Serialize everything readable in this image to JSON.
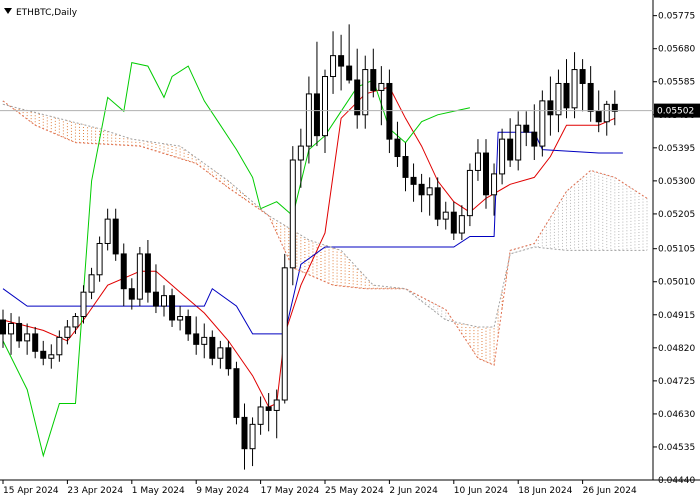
{
  "window": {
    "title": "ETHBTC,Daily",
    "arrow_icon": "triangle-down-icon"
  },
  "chart_data": {
    "type": "candlestick",
    "symbol": "ETHBTC",
    "timeframe": "Daily",
    "indicator": "Ichimoku Kinko Hyo",
    "ylim": [
      0.0444,
      0.0582
    ],
    "current_price": "0.05502",
    "y_ticks": [
      "0.05775",
      "0.05680",
      "0.05585",
      "0.05490",
      "0.05395",
      "0.05300",
      "0.05205",
      "0.05105",
      "0.05010",
      "0.04915",
      "0.04820",
      "0.04725",
      "0.04630",
      "0.04535",
      "0.04440"
    ],
    "x_labels": [
      {
        "label": "15 Apr 2024",
        "index": 0
      },
      {
        "label": "23 Apr 2024",
        "index": 8
      },
      {
        "label": "1 May 2024",
        "index": 16
      },
      {
        "label": "9 May 2024",
        "index": 24
      },
      {
        "label": "17 May 2024",
        "index": 32
      },
      {
        "label": "25 May 2024",
        "index": 40
      },
      {
        "label": "2 Jun 2024",
        "index": 48
      },
      {
        "label": "10 Jun 2024",
        "index": 56
      },
      {
        "label": "18 Jun 2024",
        "index": 64
      },
      {
        "label": "26 Jun 2024",
        "index": 72
      }
    ],
    "candles": [
      [
        0.049,
        0.0493,
        0.0482,
        0.0486
      ],
      [
        0.0486,
        0.0492,
        0.048,
        0.0489
      ],
      [
        0.0489,
        0.0491,
        0.0482,
        0.0484
      ],
      [
        0.0484,
        0.0489,
        0.048,
        0.0486
      ],
      [
        0.0486,
        0.0488,
        0.0479,
        0.0481
      ],
      [
        0.0481,
        0.0484,
        0.0477,
        0.0479
      ],
      [
        0.0479,
        0.0483,
        0.0476,
        0.048
      ],
      [
        0.048,
        0.0487,
        0.0478,
        0.0485
      ],
      [
        0.0485,
        0.049,
        0.0483,
        0.0488
      ],
      [
        0.0488,
        0.0492,
        0.0486,
        0.0491
      ],
      [
        0.0491,
        0.05,
        0.0489,
        0.0498
      ],
      [
        0.0498,
        0.0505,
        0.0496,
        0.0503
      ],
      [
        0.0503,
        0.0514,
        0.0501,
        0.0512
      ],
      [
        0.0512,
        0.0522,
        0.051,
        0.0519
      ],
      [
        0.0519,
        0.0522,
        0.0507,
        0.0509
      ],
      [
        0.0509,
        0.0512,
        0.0494,
        0.0499
      ],
      [
        0.0499,
        0.0502,
        0.0493,
        0.0496
      ],
      [
        0.0496,
        0.0511,
        0.0494,
        0.0509
      ],
      [
        0.0509,
        0.0513,
        0.0495,
        0.0498
      ],
      [
        0.0498,
        0.0506,
        0.0492,
        0.0494
      ],
      [
        0.0494,
        0.05,
        0.0491,
        0.0497
      ],
      [
        0.0497,
        0.0499,
        0.0488,
        0.049
      ],
      [
        0.049,
        0.0494,
        0.0487,
        0.0491
      ],
      [
        0.0491,
        0.0493,
        0.0484,
        0.0486
      ],
      [
        0.0486,
        0.0491,
        0.048,
        0.0483
      ],
      [
        0.0483,
        0.0489,
        0.0479,
        0.0485
      ],
      [
        0.0485,
        0.0487,
        0.0477,
        0.0479
      ],
      [
        0.0479,
        0.0484,
        0.0476,
        0.0482
      ],
      [
        0.0482,
        0.0484,
        0.0474,
        0.0476
      ],
      [
        0.0476,
        0.0478,
        0.046,
        0.0462
      ],
      [
        0.0462,
        0.0466,
        0.0447,
        0.0453
      ],
      [
        0.0453,
        0.0462,
        0.0448,
        0.046
      ],
      [
        0.046,
        0.0468,
        0.0457,
        0.0465
      ],
      [
        0.0465,
        0.0469,
        0.0458,
        0.0464
      ],
      [
        0.0464,
        0.047,
        0.0456,
        0.0467
      ],
      [
        0.0467,
        0.0509,
        0.0466,
        0.0505
      ],
      [
        0.0505,
        0.054,
        0.05,
        0.0536
      ],
      [
        0.0536,
        0.0545,
        0.0528,
        0.054
      ],
      [
        0.054,
        0.056,
        0.0535,
        0.0555
      ],
      [
        0.0555,
        0.057,
        0.054,
        0.0543
      ],
      [
        0.0543,
        0.0562,
        0.0538,
        0.056
      ],
      [
        0.056,
        0.0573,
        0.0555,
        0.0566
      ],
      [
        0.0566,
        0.0572,
        0.0556,
        0.0563
      ],
      [
        0.0563,
        0.0575,
        0.0558,
        0.0559
      ],
      [
        0.0559,
        0.0568,
        0.0545,
        0.0549
      ],
      [
        0.0549,
        0.0566,
        0.0545,
        0.0562
      ],
      [
        0.0562,
        0.0568,
        0.0554,
        0.0556
      ],
      [
        0.0556,
        0.0563,
        0.0546,
        0.0558
      ],
      [
        0.0558,
        0.0562,
        0.0538,
        0.0542
      ],
      [
        0.0542,
        0.0547,
        0.0534,
        0.0537
      ],
      [
        0.0537,
        0.0541,
        0.0527,
        0.0531
      ],
      [
        0.0531,
        0.0535,
        0.0524,
        0.0529
      ],
      [
        0.0529,
        0.0532,
        0.0521,
        0.0526
      ],
      [
        0.0526,
        0.0531,
        0.052,
        0.0528
      ],
      [
        0.0528,
        0.0531,
        0.0517,
        0.0519
      ],
      [
        0.0519,
        0.0524,
        0.0516,
        0.0521
      ],
      [
        0.0521,
        0.0524,
        0.0513,
        0.0515
      ],
      [
        0.0515,
        0.0523,
        0.0513,
        0.052
      ],
      [
        0.052,
        0.0535,
        0.0517,
        0.0533
      ],
      [
        0.0533,
        0.0542,
        0.053,
        0.0538
      ],
      [
        0.0538,
        0.0542,
        0.0522,
        0.0526
      ],
      [
        0.0526,
        0.0535,
        0.052,
        0.0532
      ],
      [
        0.0532,
        0.0545,
        0.0529,
        0.0542
      ],
      [
        0.0542,
        0.0548,
        0.0534,
        0.0536
      ],
      [
        0.0536,
        0.055,
        0.0533,
        0.0546
      ],
      [
        0.0546,
        0.055,
        0.054,
        0.0544
      ],
      [
        0.0544,
        0.0552,
        0.0536,
        0.054
      ],
      [
        0.054,
        0.0556,
        0.0537,
        0.0553
      ],
      [
        0.0553,
        0.056,
        0.0543,
        0.0549
      ],
      [
        0.0549,
        0.0562,
        0.0544,
        0.0558
      ],
      [
        0.0558,
        0.0565,
        0.0548,
        0.0551
      ],
      [
        0.0551,
        0.0567,
        0.0548,
        0.0562
      ],
      [
        0.0562,
        0.0565,
        0.055,
        0.0558
      ],
      [
        0.0558,
        0.0563,
        0.0547,
        0.055
      ],
      [
        0.055,
        0.0556,
        0.0544,
        0.0547
      ],
      [
        0.0547,
        0.0553,
        0.0543,
        0.0552
      ],
      [
        0.0552,
        0.0556,
        0.0546,
        0.055
      ]
    ],
    "series": [
      {
        "key": "tenkan",
        "color": "#e00000",
        "points": [
          [
            0,
            0.049
          ],
          [
            5,
            0.0487
          ],
          [
            8,
            0.0484
          ],
          [
            10,
            0.049
          ],
          [
            13,
            0.05
          ],
          [
            17,
            0.0504
          ],
          [
            19,
            0.0504
          ],
          [
            22,
            0.0498
          ],
          [
            25,
            0.0492
          ],
          [
            28,
            0.0484
          ],
          [
            31,
            0.0474
          ],
          [
            33,
            0.0465
          ],
          [
            34,
            0.0466
          ],
          [
            35,
            0.0486
          ],
          [
            37,
            0.05
          ],
          [
            40,
            0.0515
          ],
          [
            42,
            0.0548
          ],
          [
            45,
            0.0555
          ],
          [
            48,
            0.0557
          ],
          [
            50,
            0.0548
          ],
          [
            52,
            0.054
          ],
          [
            54,
            0.053
          ],
          [
            56,
            0.0524
          ],
          [
            58,
            0.0521
          ],
          [
            60,
            0.0525
          ],
          [
            63,
            0.0529
          ],
          [
            66,
            0.0531
          ],
          [
            68,
            0.0537
          ],
          [
            70,
            0.0546
          ],
          [
            72,
            0.0546
          ],
          [
            74,
            0.0546
          ],
          [
            76,
            0.0548
          ]
        ]
      },
      {
        "key": "kijun",
        "color": "#0000c0",
        "points": [
          [
            0,
            0.0499
          ],
          [
            3,
            0.0494
          ],
          [
            13,
            0.0494
          ],
          [
            25,
            0.0494
          ],
          [
            26,
            0.0499
          ],
          [
            29,
            0.0494
          ],
          [
            31,
            0.0486
          ],
          [
            35,
            0.0486
          ],
          [
            37,
            0.0506
          ],
          [
            40,
            0.0511
          ],
          [
            56,
            0.0511
          ],
          [
            58,
            0.0514
          ],
          [
            61,
            0.0514
          ],
          [
            61.5,
            0.0544
          ],
          [
            66,
            0.0544
          ],
          [
            67,
            0.0539
          ],
          [
            74,
            0.0538
          ],
          [
            77,
            0.0538
          ]
        ]
      },
      {
        "key": "chikou",
        "color": "#00cc00",
        "points": [
          [
            0,
            0.0484
          ],
          [
            3,
            0.047
          ],
          [
            5,
            0.0451
          ],
          [
            7,
            0.0466
          ],
          [
            9,
            0.0466
          ],
          [
            11,
            0.053
          ],
          [
            13,
            0.0554
          ],
          [
            15,
            0.055
          ],
          [
            16,
            0.0564
          ],
          [
            18,
            0.0563
          ],
          [
            20,
            0.0554
          ],
          [
            21,
            0.056
          ],
          [
            23,
            0.0563
          ],
          [
            25,
            0.0553
          ],
          [
            27,
            0.0546
          ],
          [
            29,
            0.0539
          ],
          [
            31,
            0.0531
          ],
          [
            32,
            0.0522
          ],
          [
            34,
            0.0524
          ],
          [
            36,
            0.052
          ],
          [
            38,
            0.0539
          ],
          [
            40,
            0.0543
          ],
          [
            42,
            0.055
          ],
          [
            44,
            0.0557
          ],
          [
            46,
            0.0559
          ],
          [
            48,
            0.0545
          ],
          [
            50,
            0.0541
          ],
          [
            52,
            0.0547
          ],
          [
            54,
            0.0549
          ],
          [
            56,
            0.055
          ],
          [
            58,
            0.0551
          ]
        ]
      },
      {
        "key": "senkou_a",
        "color": "#e07050",
        "points": [
          [
            0,
            0.0553
          ],
          [
            4,
            0.0546
          ],
          [
            9,
            0.0541
          ],
          [
            17,
            0.054
          ],
          [
            24,
            0.0535
          ],
          [
            28,
            0.0528
          ],
          [
            33,
            0.052
          ],
          [
            36,
            0.0505
          ],
          [
            41,
            0.05
          ],
          [
            45,
            0.0499
          ],
          [
            50,
            0.0499
          ],
          [
            55,
            0.0493
          ],
          [
            59,
            0.0479
          ],
          [
            61,
            0.0477
          ],
          [
            63,
            0.051
          ],
          [
            66,
            0.0512
          ],
          [
            70,
            0.0527
          ],
          [
            73,
            0.0533
          ],
          [
            76,
            0.0531
          ],
          [
            80,
            0.0525
          ]
        ]
      },
      {
        "key": "senkou_b",
        "color": "#a0a0a0",
        "points": [
          [
            0,
            0.0552
          ],
          [
            12,
            0.0545
          ],
          [
            16,
            0.0542
          ],
          [
            22,
            0.054
          ],
          [
            28,
            0.053
          ],
          [
            33,
            0.052
          ],
          [
            38,
            0.0513
          ],
          [
            42,
            0.051
          ],
          [
            46,
            0.05
          ],
          [
            50,
            0.0499
          ],
          [
            55,
            0.049
          ],
          [
            59,
            0.0488
          ],
          [
            61,
            0.0488
          ],
          [
            63,
            0.0509
          ],
          [
            66,
            0.0511
          ],
          [
            70,
            0.051
          ],
          [
            76,
            0.051
          ],
          [
            80,
            0.051
          ]
        ]
      }
    ]
  }
}
